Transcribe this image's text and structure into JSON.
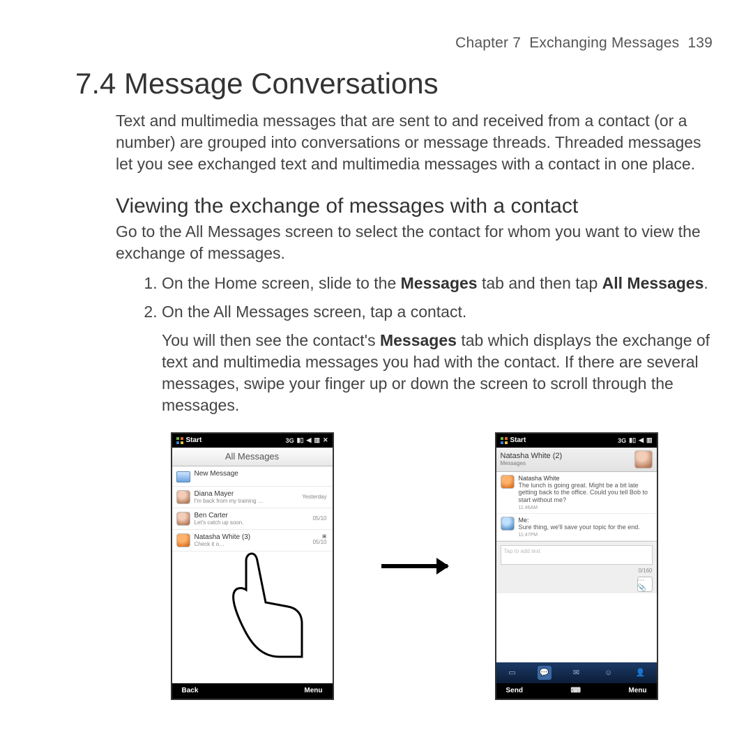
{
  "header": {
    "chapter": "Chapter 7",
    "chapter_title": "Exchanging Messages",
    "page_num": "139"
  },
  "h1": "7.4   Message Conversations",
  "intro": "Text and multimedia messages that are sent to and received from a contact (or a number) are grouped into conversations or message threads. Threaded messages let you see exchanged text and multimedia messages with a contact in one place.",
  "h2": "Viewing the exchange of messages with a contact",
  "lead": "Go to the All Messages screen to select the contact for whom you want to view the exchange of messages.",
  "step1": {
    "pre": "On the Home screen, slide to the ",
    "bold1": "Messages",
    "mid": " tab and then tap ",
    "bold2": "All Messages",
    "post": "."
  },
  "step2": {
    "line": "On the All Messages screen, tap a contact.",
    "sub_pre": "You will then see the contact's ",
    "sub_bold": "Messages",
    "sub_post": " tab which displays the exchange of text and multimedia messages you had with the contact. If there are several messages, swipe your finger up or down the screen to scroll through the messages."
  },
  "phone_left": {
    "start": "Start",
    "close": "✕",
    "title": "All Messages",
    "new_msg": "New Message",
    "items": [
      {
        "name": "Diana Mayer",
        "sub": "I'm back from my training …",
        "meta": "Yesterday"
      },
      {
        "name": "Ben Carter",
        "sub": "Let's catch up soon.",
        "meta": "05/10"
      },
      {
        "name": "Natasha White (3)",
        "sub": "Check it o…",
        "meta": "05/10",
        "mms": "▣"
      }
    ],
    "sk_left": "Back",
    "sk_right": "Menu"
  },
  "phone_right": {
    "start": "Start",
    "contact": "Natasha White (2)",
    "tab": "Messages",
    "msgs": [
      {
        "who": "Natasha White",
        "text": "The lunch is going great. Might be a bit late getting back to the office. Could you tell Bob to start without me?",
        "when": "11:46AM"
      },
      {
        "who": "Me:",
        "text": "Sure thing, we'll save your topic for the end.",
        "when": "11:47PM"
      }
    ],
    "compose_placeholder": "Tap to add text",
    "count": "0/160",
    "sk_left": "Send",
    "sk_right": "Menu",
    "sk_mid": "⌨"
  }
}
